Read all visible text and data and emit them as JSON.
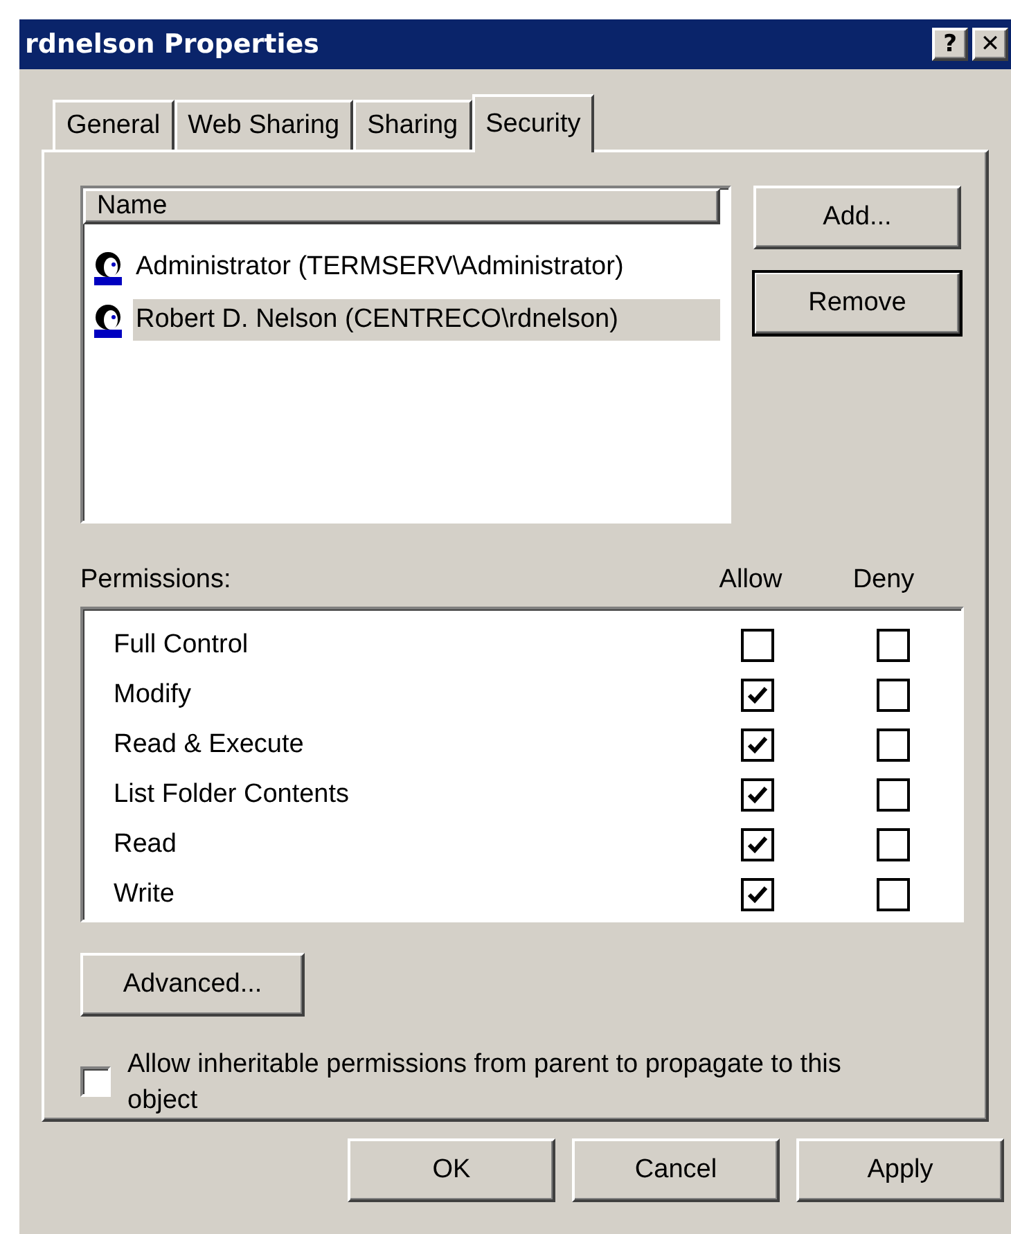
{
  "window": {
    "title": "rdnelson Properties",
    "help_button": "?",
    "close_button": "✕"
  },
  "tabs": [
    {
      "label": "General",
      "selected": false
    },
    {
      "label": "Web Sharing",
      "selected": false
    },
    {
      "label": "Sharing",
      "selected": false
    },
    {
      "label": "Security",
      "selected": true
    }
  ],
  "users": {
    "column": "Name",
    "rows": [
      {
        "name": "Administrator (TERMSERV\\Administrator)",
        "selected": false
      },
      {
        "name": "Robert D. Nelson (CENTRECO\\rdnelson)",
        "selected": true
      }
    ]
  },
  "user_buttons": [
    {
      "label": "Add...",
      "default": false
    },
    {
      "label": "Remove",
      "default": true
    }
  ],
  "permissions": {
    "label": "Permissions:",
    "allow_header": "Allow",
    "deny_header": "Deny",
    "rows": [
      {
        "name": "Full Control",
        "allow": false,
        "deny": false
      },
      {
        "name": "Modify",
        "allow": true,
        "deny": false
      },
      {
        "name": "Read & Execute",
        "allow": true,
        "deny": false
      },
      {
        "name": "List Folder Contents",
        "allow": true,
        "deny": false
      },
      {
        "name": "Read",
        "allow": true,
        "deny": false
      },
      {
        "name": "Write",
        "allow": true,
        "deny": false
      }
    ]
  },
  "advanced_button": "Advanced...",
  "inherit": {
    "label": "Allow inheritable permissions from parent to propagate to this object",
    "checked": false
  },
  "footer_buttons": [
    "OK",
    "Cancel",
    "Apply"
  ]
}
